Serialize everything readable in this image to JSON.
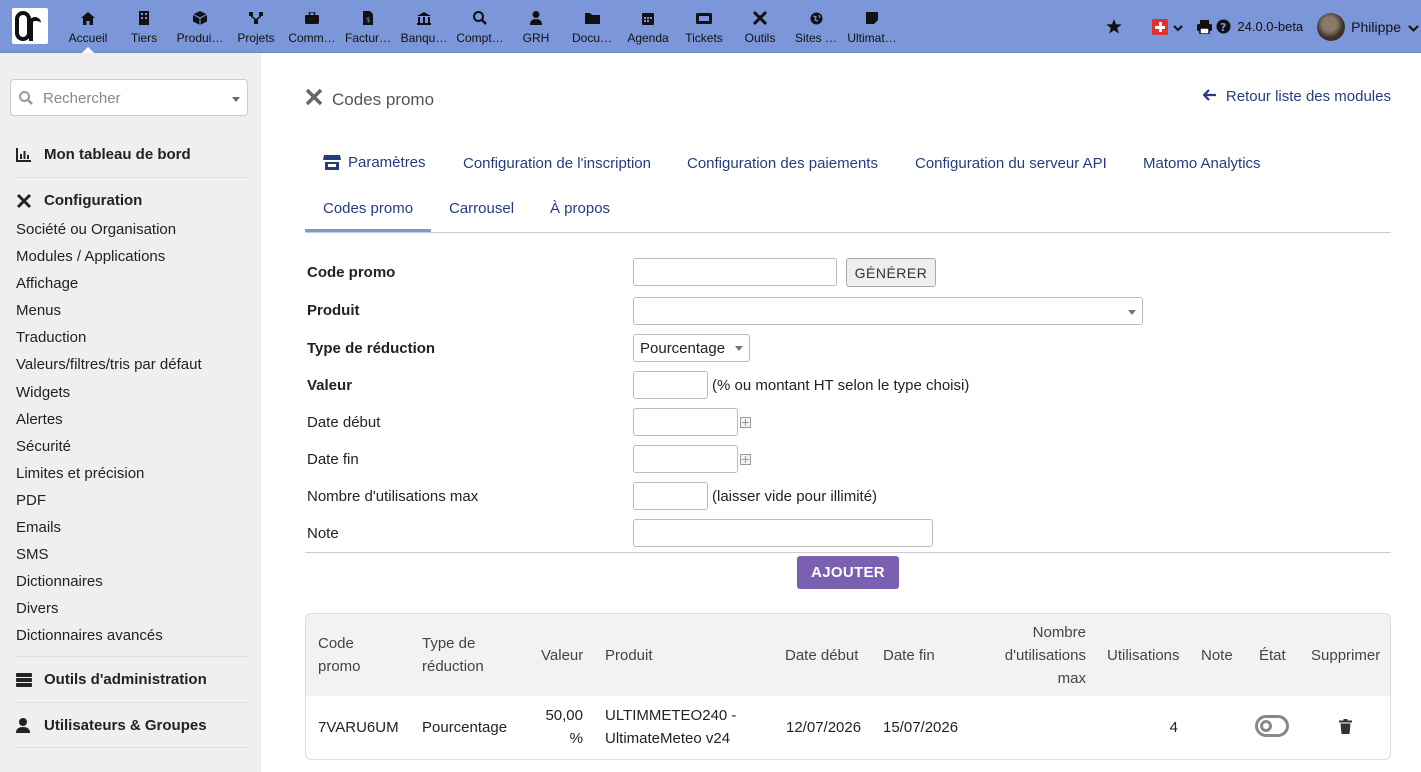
{
  "topbar": {
    "nav": [
      {
        "label": "Accueil",
        "icon": "home-icon"
      },
      {
        "label": "Tiers",
        "icon": "building-icon"
      },
      {
        "label": "Produi…",
        "icon": "cube-icon"
      },
      {
        "label": "Projets",
        "icon": "sitemap-icon"
      },
      {
        "label": "Comm…",
        "icon": "suitcase-icon"
      },
      {
        "label": "Factur…",
        "icon": "invoice-icon"
      },
      {
        "label": "Banqu…",
        "icon": "bank-icon"
      },
      {
        "label": "Compt…",
        "icon": "search-dollar-icon"
      },
      {
        "label": "GRH",
        "icon": "user-tie-icon"
      },
      {
        "label": "Docu…",
        "icon": "folder-icon"
      },
      {
        "label": "Agenda",
        "icon": "calendar-icon"
      },
      {
        "label": "Tickets",
        "icon": "ticket-icon"
      },
      {
        "label": "Outils",
        "icon": "tools-icon"
      },
      {
        "label": "Sites …",
        "icon": "globe-icon"
      },
      {
        "label": "Ultimat…",
        "icon": "sticky-note-icon"
      }
    ],
    "version": "24.0.0-beta",
    "user": "Philippe"
  },
  "sidebar": {
    "search_placeholder": "Rechercher",
    "dashboard": "Mon tableau de bord",
    "configuration": "Configuration",
    "links": [
      "Société ou Organisation",
      "Modules / Applications",
      "Affichage",
      "Menus",
      "Traduction",
      "Valeurs/filtres/tris par défaut",
      "Widgets",
      "Alertes",
      "Sécurité",
      "Limites et précision",
      "PDF",
      "Emails",
      "SMS",
      "Dictionnaires",
      "Divers",
      "Dictionnaires avancés"
    ],
    "admin_tools": "Outils d'administration",
    "users_groups": "Utilisateurs & Groupes"
  },
  "main": {
    "title": "Codes promo",
    "back_link": "Retour liste des modules",
    "tabs_row1": [
      "Paramètres",
      "Configuration de l'inscription",
      "Configuration des paiements",
      "Configuration du serveur API",
      "Matomo Analytics"
    ],
    "tabs_row2": [
      "Codes promo",
      "Carrousel",
      "À propos"
    ],
    "form": {
      "code_label": "Code promo",
      "generate_label": "GÉNÉRER",
      "product_label": "Produit",
      "type_label": "Type de réduction",
      "type_value": "Pourcentage",
      "value_label": "Valeur",
      "value_hint": "(% ou montant HT selon le type choisi)",
      "start_label": "Date début",
      "end_label": "Date fin",
      "max_label": "Nombre d'utilisations max",
      "max_hint": "(laisser vide pour illimité)",
      "note_label": "Note",
      "add_label": "AJOUTER"
    },
    "table": {
      "headers": {
        "code_l1": "Code",
        "code_l2": "promo",
        "type_l1": "Type de",
        "type_l2": "réduction",
        "value": "Valeur",
        "product": "Produit",
        "start": "Date début",
        "end": "Date fin",
        "max_l1": "Nombre",
        "max_l2": "d'utilisations",
        "max_l3": "max",
        "uses": "Utilisations",
        "note": "Note",
        "state": "État",
        "delete": "Supprimer"
      },
      "rows": [
        {
          "code": "7VARU6UM",
          "type": "Pourcentage",
          "value_l1": "50,00",
          "value_l2": "%",
          "product_l1": "ULTIMMETEO240 -",
          "product_l2": "UltimateMeteo v24",
          "start": "12/07/2026",
          "end": "15/07/2026",
          "max": "",
          "uses": "4",
          "note": "",
          "state": "off"
        }
      ]
    }
  },
  "colors": {
    "topbar": "#7b96d9",
    "accent": "#7b5fb0",
    "link": "#263c7e",
    "sidebar": "#efefef"
  }
}
